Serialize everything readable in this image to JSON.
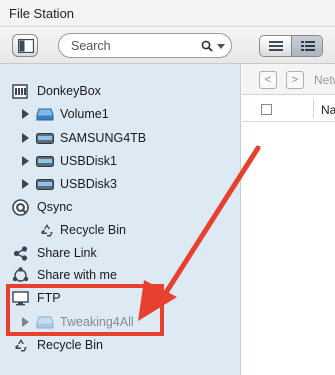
{
  "window": {
    "title": "File Station"
  },
  "toolbar": {
    "sidebar_toggle_icon": "sidebar-panel-icon",
    "search": {
      "placeholder": "Search"
    },
    "view_list_icon": "list-view-icon",
    "view_detail_icon": "detail-view-icon"
  },
  "sidebar": {
    "groups": [
      {
        "label": "DonkeyBox",
        "icon": "nas-server-icon"
      },
      {
        "label": "Volume1",
        "icon": "volume-drive-icon"
      },
      {
        "label": "SAMSUNG4TB",
        "icon": "usb-drive-icon"
      },
      {
        "label": "USBDisk1",
        "icon": "usb-drive-icon"
      },
      {
        "label": "USBDisk3",
        "icon": "usb-drive-icon"
      },
      {
        "label": "Qsync",
        "icon": "qsync-icon"
      },
      {
        "label": "Recycle Bin",
        "icon": "recycle-bin-icon"
      },
      {
        "label": "Share Link",
        "icon": "share-link-icon"
      },
      {
        "label": "Share with me",
        "icon": "share-with-me-icon"
      },
      {
        "label": "FTP",
        "icon": "ftp-monitor-icon"
      },
      {
        "label": "Tweaking4All",
        "icon": "ftp-drive-icon"
      },
      {
        "label": "Recycle Bin",
        "icon": "recycle-bin-icon"
      }
    ]
  },
  "content": {
    "nav_back": "<",
    "nav_forward": ">",
    "path_label": "Netw",
    "column_name": "Na"
  },
  "annotation": {
    "color": "#e8402f"
  }
}
